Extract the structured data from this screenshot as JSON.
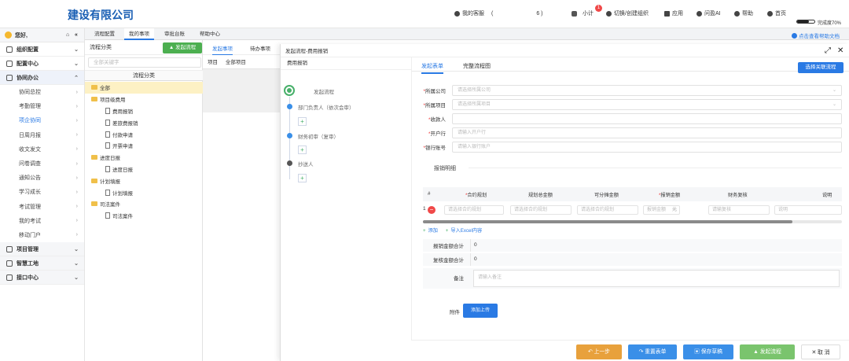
{
  "app": {
    "company": "建设有限公司"
  },
  "topnav": {
    "customer_label": "我的客服",
    "customer_info": "6 )",
    "customer_open": "(",
    "small_label": "小计",
    "badge": "1",
    "switch_label": "切换/创建组织",
    "apps_label": "应用",
    "ai_label": "问盈AI",
    "help_label": "帮助",
    "home_label": "首页",
    "progress_label": "完成度70%",
    "progress": 0.7
  },
  "sidebar": {
    "greeting": "您好,",
    "sections": [
      {
        "label": "组织配置"
      },
      {
        "label": "配置中心"
      },
      {
        "label": "协同办公"
      }
    ],
    "items": [
      "协同总控",
      "考勤管理",
      "项企协同",
      "日周月报",
      "收文发文",
      "问卷调查",
      "通知公告",
      "学习成长",
      "考试管理",
      "我的考试",
      "移动门户"
    ],
    "bottom_sections": [
      {
        "label": "项目管理"
      },
      {
        "label": "智慧工地"
      },
      {
        "label": "接口中心"
      }
    ]
  },
  "tabs": [
    "流程配置",
    "我的事项",
    "审批台账",
    "帮助中心"
  ],
  "help_link": "点击查看帮助文档",
  "left_panel": {
    "title": "流程分类",
    "start_btn": "发起流程",
    "search_placeholder": "全部关键字",
    "tree_header": "流程分类",
    "tree": [
      {
        "label": "全部",
        "type": "folder",
        "level": 0,
        "selected": true
      },
      {
        "label": "项目级费用",
        "type": "folder",
        "level": 0
      },
      {
        "label": "费用报销",
        "type": "doc",
        "level": 1
      },
      {
        "label": "差旅费报销",
        "type": "doc",
        "level": 1
      },
      {
        "label": "付款申请",
        "type": "doc",
        "level": 1
      },
      {
        "label": "开票申请",
        "type": "doc",
        "level": 1
      },
      {
        "label": "进度日报",
        "type": "folder",
        "level": 0
      },
      {
        "label": "进度日报",
        "type": "doc",
        "level": 1
      },
      {
        "label": "计划填报",
        "type": "folder",
        "level": 0
      },
      {
        "label": "计划填报",
        "type": "doc",
        "level": 1
      },
      {
        "label": "司法案件",
        "type": "folder",
        "level": 0
      },
      {
        "label": "司法案件",
        "type": "doc",
        "level": 1
      }
    ]
  },
  "mid_panel": {
    "tab_start": "发起事项",
    "tab_todo": "待办事项",
    "col_project": "项目",
    "col_all": "全部项目"
  },
  "dialog": {
    "title": "发起流程-费用报销",
    "flow_sub": "费用报销",
    "flow_nodes": [
      "发起流程",
      "部门负责人（依次会审）",
      "财务初审（复审）",
      "抄送人"
    ],
    "plus": "+",
    "tab_form": "发起表单",
    "tab_diagram": "完整流程图",
    "related_btn": "选择关联流程",
    "fields": [
      {
        "label": "所属公司",
        "required": true,
        "placeholder": "请选择所属公司",
        "dropdown": true
      },
      {
        "label": "所属项目",
        "required": true,
        "placeholder": "请选择所属项目",
        "dropdown": true
      },
      {
        "label": "收款人",
        "required": true,
        "placeholder": "",
        "dropdown": false
      },
      {
        "label": "开户行",
        "required": true,
        "placeholder": "请输入开户行",
        "dropdown": false
      },
      {
        "label": "银行账号",
        "required": true,
        "placeholder": "请输入银行账户",
        "dropdown": false
      }
    ],
    "detail_title": "报销明细",
    "table_headers": [
      "#",
      "合约规划",
      "规划总金额",
      "可分摊金额",
      "报销金额",
      "财务复核",
      "说明"
    ],
    "table_row": {
      "index": "1",
      "cells": [
        "请选择合约规划",
        "请选择合约规划",
        "请选择合约规划",
        "报销金额",
        "请输复核",
        "说明"
      ],
      "unit": "元"
    },
    "add_label": "添加",
    "import_label": "导入Excel内容",
    "sum_total_label": "报销金额合计",
    "sum_total": "0",
    "sum_review_label": "复核金额合计",
    "sum_review": "0",
    "notes_label": "备注",
    "notes_placeholder": "请输入备注",
    "attach_label": "附件",
    "upload_btn": "添加上传"
  },
  "footer": {
    "prev": "上一步",
    "reset": "重置表单",
    "save": "保存草稿",
    "submit": "发起流程",
    "cancel": "取 消"
  },
  "colors": {
    "accent": "#2a7ae4",
    "brand": "#1a5fb4",
    "green": "#4caf50",
    "orange": "#e8a13c",
    "danger": "#f04848"
  }
}
